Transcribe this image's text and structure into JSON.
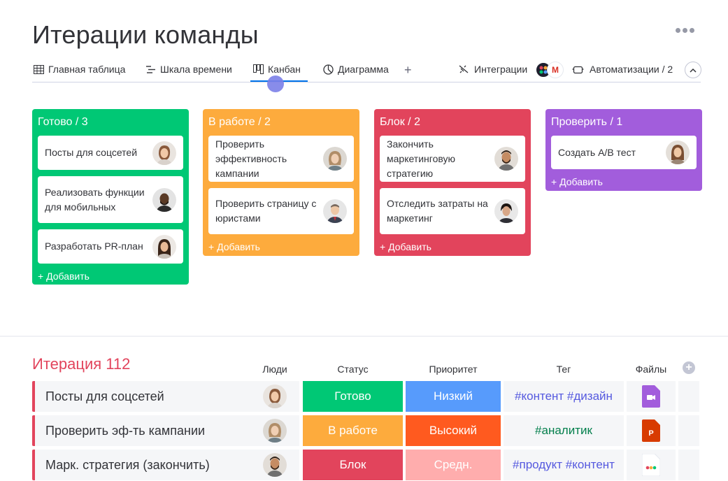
{
  "board": {
    "title": "Итерации команды"
  },
  "tabs": [
    {
      "label": "Главная таблица",
      "icon": "table-icon"
    },
    {
      "label": "Шкала времени",
      "icon": "timeline-icon"
    },
    {
      "label": "Канбан",
      "icon": "kanban-icon",
      "active": true
    },
    {
      "label": "Диаграмма",
      "icon": "chart-icon"
    }
  ],
  "toolbar": {
    "add_view": "+",
    "integrations_label": "Интеграции",
    "automations_label": "Автоматизации / 2"
  },
  "kanban": {
    "columns": [
      {
        "title": "Готово / 3",
        "color": "#00c875",
        "add": "+ Добавить",
        "cards": [
          "Посты для соцсетей",
          "Реализовать функции для мобильных",
          "Разработать PR-план"
        ]
      },
      {
        "title": "В работе / 2",
        "color": "#fdab3d",
        "add": "+ Добавить",
        "cards": [
          "Проверить эффективность кампании",
          "Проверить страницу с юристами"
        ]
      },
      {
        "title": "Блок / 2",
        "color": "#e2445c",
        "add": "+ Добавить",
        "cards": [
          "Закончить маркетинговую стратегию",
          "Отследить затраты на маркетинг"
        ]
      },
      {
        "title": "Проверить / 1",
        "color": "#a25ddc",
        "add": "+ Добавить",
        "cards": [
          "Создать A/B тест"
        ]
      }
    ]
  },
  "table": {
    "group_title": "Итерация 112",
    "group_color": "#e2445c",
    "columns": {
      "people": "Люди",
      "status": "Статус",
      "priority": "Приоритет",
      "tag": "Тег",
      "files": "Файлы"
    },
    "add_column": "+",
    "rows": [
      {
        "name": "Посты для соцсетей",
        "status": "Готово",
        "status_color": "#00c875",
        "priority": "Низкий",
        "priority_color": "#579bfc",
        "tag": "#контент #дизайн",
        "file_icon": "video-file-icon"
      },
      {
        "name": "Проверить эф-ть кампании",
        "status": "В работе",
        "status_color": "#fdab3d",
        "priority": "Высокий",
        "priority_color": "#ff5a1f",
        "tag": "#аналитик",
        "file_icon": "presentation-file-icon"
      },
      {
        "name": "Марк. стратегия (закончить)",
        "status": "Блок",
        "status_color": "#e2445c",
        "priority": "Средн.",
        "priority_color": "#ffadad",
        "tag": "#продукт #контент",
        "file_icon": "monday-file-icon"
      }
    ]
  }
}
